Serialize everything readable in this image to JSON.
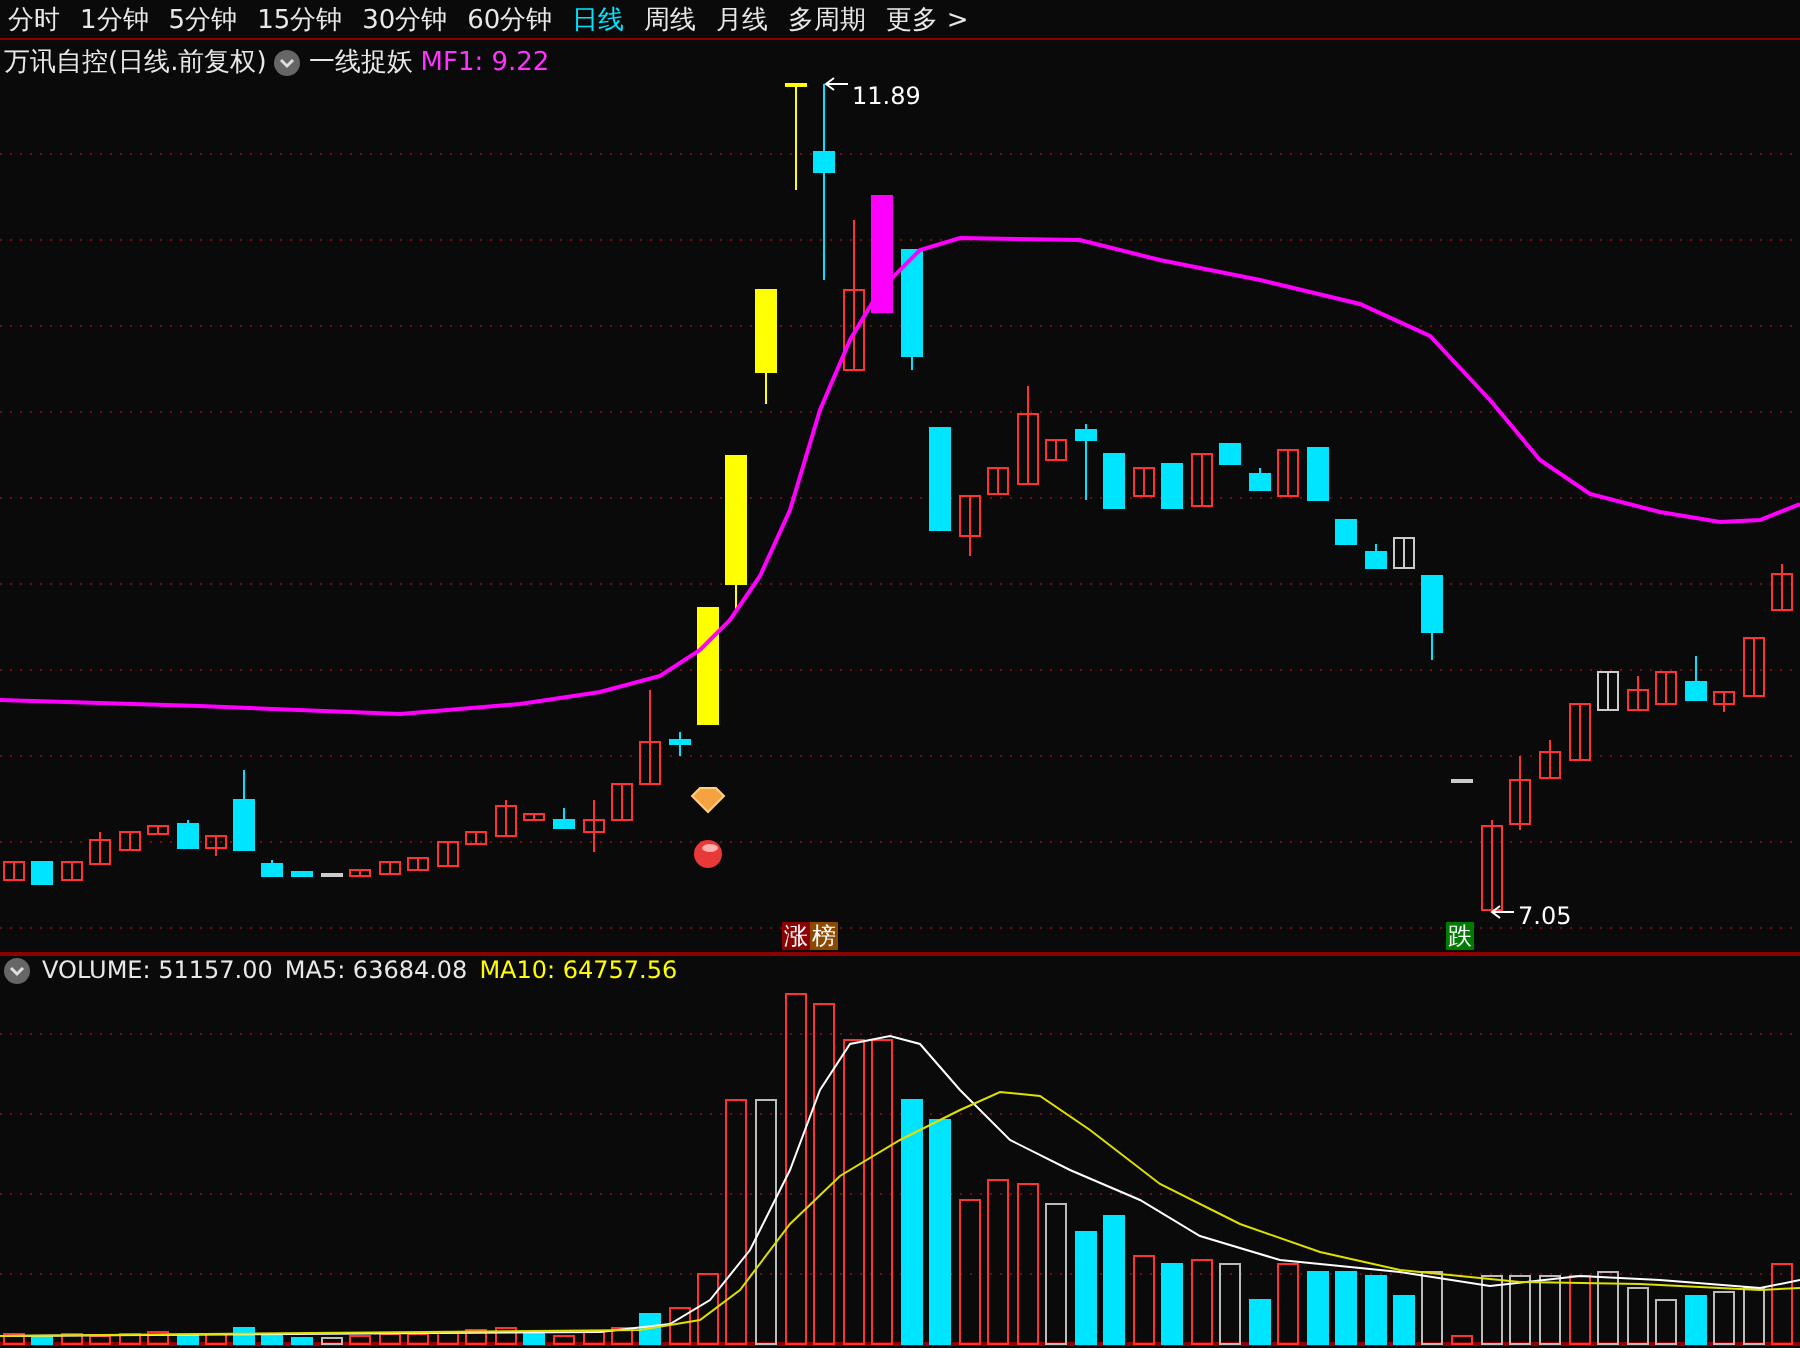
{
  "tabs": [
    {
      "label": "分时",
      "selected": false
    },
    {
      "label": "1分钟",
      "selected": false
    },
    {
      "label": "5分钟",
      "selected": false
    },
    {
      "label": "15分钟",
      "selected": false
    },
    {
      "label": "30分钟",
      "selected": false
    },
    {
      "label": "60分钟",
      "selected": false
    },
    {
      "label": "日线",
      "selected": true
    },
    {
      "label": "周线",
      "selected": false
    },
    {
      "label": "月线",
      "selected": false
    },
    {
      "label": "多周期",
      "selected": false
    },
    {
      "label": "更多 >",
      "selected": false
    }
  ],
  "chart": {
    "title": "万讯自控(日线.前复权)",
    "indicator": "一线捉妖",
    "mf1": "MF1: 9.22",
    "high_label": "11.89",
    "low_label": "7.05",
    "markers": [
      {
        "text": "涨",
        "color": "#8b0000"
      },
      {
        "text": "榜",
        "color": "#8b4a00"
      },
      {
        "text": "跌",
        "color": "#007a00"
      }
    ]
  },
  "volume": {
    "label": "VOLUME: 51157.00",
    "ma5": "MA5: 63684.08",
    "ma10": "MA10: 64757.56"
  }
}
